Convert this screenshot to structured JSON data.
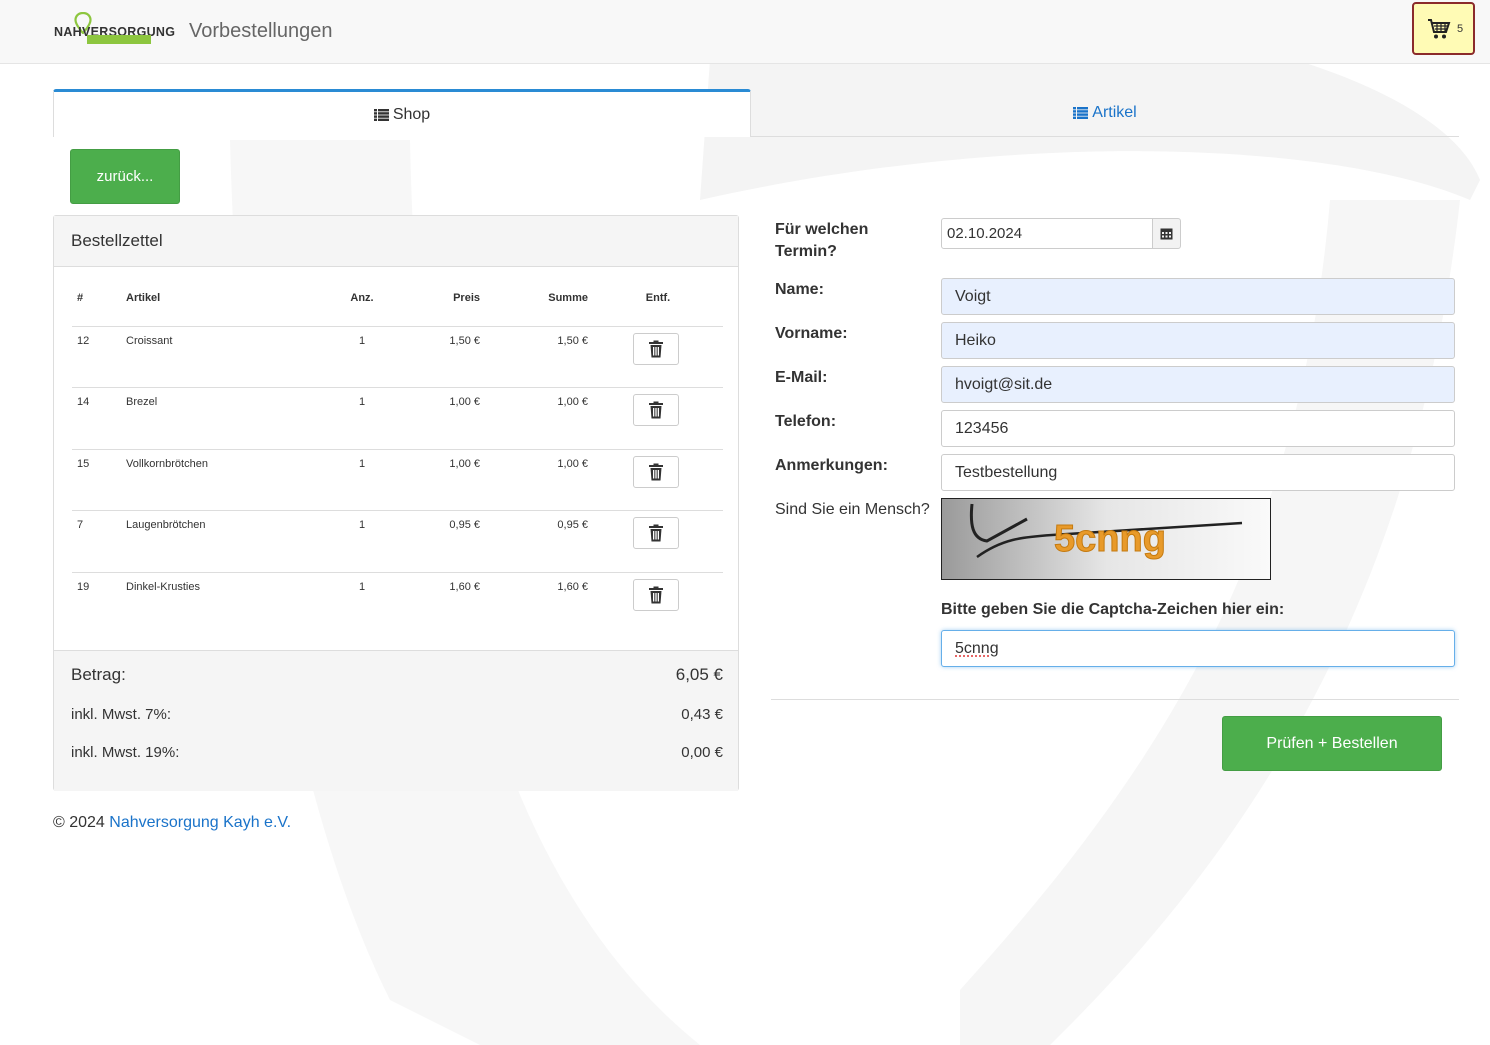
{
  "header": {
    "logo_text": "NAHVERSORGUNG",
    "title": "Vorbestellungen",
    "cart_count": "5"
  },
  "tabs": [
    {
      "label": "Shop",
      "active": true
    },
    {
      "label": "Artikel",
      "active": false
    }
  ],
  "back_button": "zurück...",
  "order": {
    "title": "Bestellzettel",
    "columns": [
      "#",
      "Artikel",
      "Anz.",
      "Preis",
      "Summe",
      "Entf."
    ],
    "rows": [
      {
        "num": "12",
        "artikel": "Croissant",
        "anz": "1",
        "preis": "1,50 €",
        "summe": "1,50 €"
      },
      {
        "num": "14",
        "artikel": "Brezel",
        "anz": "1",
        "preis": "1,00 €",
        "summe": "1,00 €"
      },
      {
        "num": "15",
        "artikel": "Vollkornbrötchen",
        "anz": "1",
        "preis": "1,00 €",
        "summe": "1,00 €"
      },
      {
        "num": "7",
        "artikel": "Laugenbrötchen",
        "anz": "1",
        "preis": "0,95 €",
        "summe": "0,95 €"
      },
      {
        "num": "19",
        "artikel": "Dinkel-Krusties",
        "anz": "1",
        "preis": "1,60 €",
        "summe": "1,60 €"
      }
    ],
    "betrag_label": "Betrag:",
    "betrag_value": "6,05 €",
    "mwst7_label": "inkl. Mwst. 7%:",
    "mwst7_value": "0,43 €",
    "mwst19_label": "inkl. Mwst. 19%:",
    "mwst19_value": "0,00 €"
  },
  "form": {
    "termin_label_1": "Für welchen",
    "termin_label_2": "Termin?",
    "termin_value": "02.10.2024",
    "name_label": "Name:",
    "name_value": "Voigt",
    "vorname_label": "Vorname:",
    "vorname_value": "Heiko",
    "email_label": "E-Mail:",
    "email_value": "hvoigt@sit.de",
    "telefon_label": "Telefon:",
    "telefon_value": "123456",
    "anmerkungen_label": "Anmerkungen:",
    "anmerkungen_value": "Testbestellung",
    "mensch_label": "Sind Sie ein Mensch?",
    "captcha_text": "5cnng",
    "captcha_prompt": "Bitte geben Sie die Captcha-Zeichen hier ein:",
    "captcha_value": "5cnng",
    "submit_label": "Prüfen + Bestellen"
  },
  "footer": {
    "copyright": "© 2024",
    "link": "Nahversorgung Kayh e.V."
  },
  "colors": {
    "primary_green": "#4cae4c",
    "link_blue": "#1a73c9",
    "tab_accent": "#2a8bd4",
    "cart_bg": "#fffbb5",
    "cart_border": "#8b2b2b",
    "autofill_bg": "#e8f0fe"
  }
}
